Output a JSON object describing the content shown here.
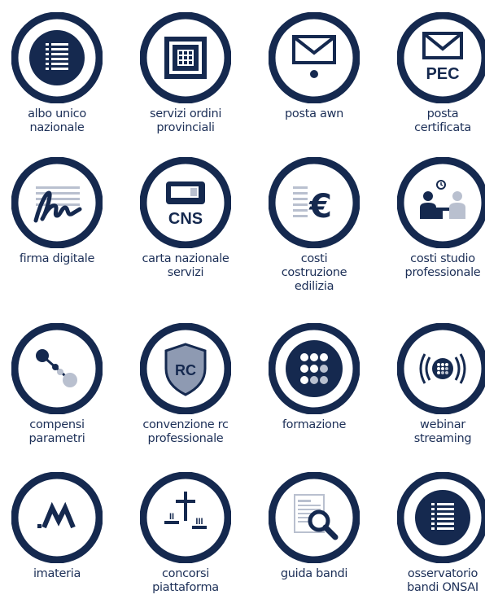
{
  "colors": {
    "ring": "#15294f",
    "label": "#1c2f57",
    "accent_grey": "#b9c0cf"
  },
  "tiles": [
    {
      "icon": "list-icon",
      "label": "albo unico\nnazionale"
    },
    {
      "icon": "building-icon",
      "label": "servizi ordini\nprovinciali"
    },
    {
      "icon": "mail-icon",
      "label": "posta awn"
    },
    {
      "icon": "pec-mail-icon",
      "label": "posta\ncertificata",
      "badge": "PEC"
    },
    {
      "icon": "signature-icon",
      "label": "firma digitale"
    },
    {
      "icon": "cns-card-icon",
      "label": "carta nazionale\nservizi",
      "badge": "CNS"
    },
    {
      "icon": "euro-icon",
      "label": "costi\ncostruzione\nedilizia",
      "badge": "€"
    },
    {
      "icon": "meeting-icon",
      "label": "costi studio\nprofessionale"
    },
    {
      "icon": "network-icon",
      "label": "compensi\nparametri"
    },
    {
      "icon": "shield-icon",
      "label": "convenzione rc\nprofessionale",
      "badge": "RC"
    },
    {
      "icon": "dots-grid-icon",
      "label": "formazione"
    },
    {
      "icon": "broadcast-icon",
      "label": "webinar\nstreaming"
    },
    {
      "icon": "imateria-logo-icon",
      "label": "imateria"
    },
    {
      "icon": "podium-icon",
      "label": "concorsi\npiattaforma",
      "badge_left": "II",
      "badge_right": "III"
    },
    {
      "icon": "document-search-icon",
      "label": "guida bandi"
    },
    {
      "icon": "list-icon",
      "label": "osservatorio\nbandi ONSAI"
    }
  ]
}
